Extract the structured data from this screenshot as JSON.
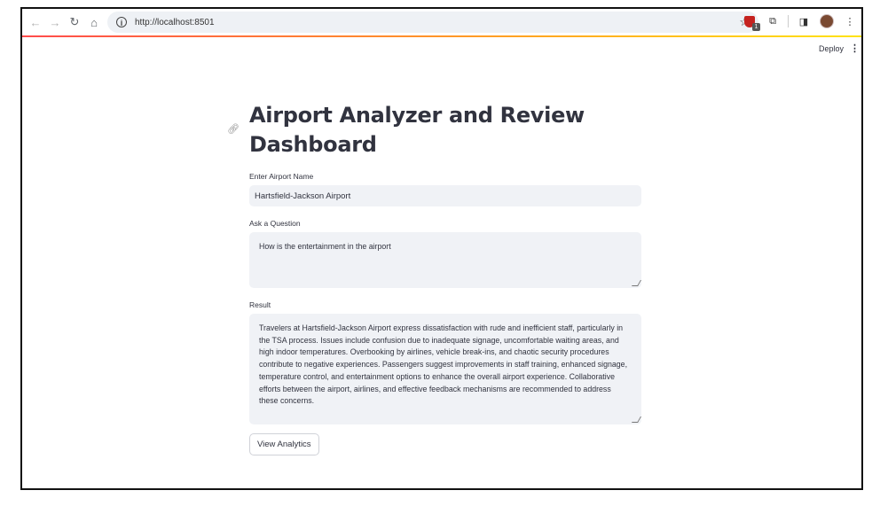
{
  "browser": {
    "url": "http://localhost:8501",
    "extension_badge": "1"
  },
  "header": {
    "deploy_label": "Deploy",
    "menu_glyph": "⋮"
  },
  "main": {
    "title_line1": "Airport Analyzer and Review",
    "title_line2": "Dashboard",
    "airport_label": "Enter Airport Name",
    "airport_value": "Hartsfield-Jackson Airport",
    "question_label": "Ask a Question",
    "question_value": "How is the entertainment in the airport",
    "result_label": "Result",
    "result_value": "Travelers at Hartsfield-Jackson Airport express dissatisfaction with rude and inefficient staff, particularly in the TSA process. Issues include confusion due to inadequate signage, uncomfortable waiting areas, and high indoor temperatures. Overbooking by airlines, vehicle break-ins, and chaotic security procedures contribute to negative experiences. Passengers suggest improvements in staff training, enhanced signage, temperature control, and entertainment options to enhance the overall airport experience. Collaborative efforts between the airport, airlines, and effective feedback mechanisms are recommended to address these concerns.",
    "analytics_button": "View Analytics"
  },
  "icons": [
    "back-icon",
    "forward-icon",
    "reload-icon",
    "home-icon",
    "info-icon",
    "star-icon",
    "extension-shield-icon",
    "puzzle-icon",
    "side-panel-icon",
    "avatar",
    "kebab-menu-icon",
    "link-icon"
  ],
  "colors": {
    "accent_gradient": [
      "#ff4b4b",
      "#ffa421",
      "#ffe312"
    ],
    "input_bg": "#f0f2f6",
    "text": "#31333f"
  }
}
